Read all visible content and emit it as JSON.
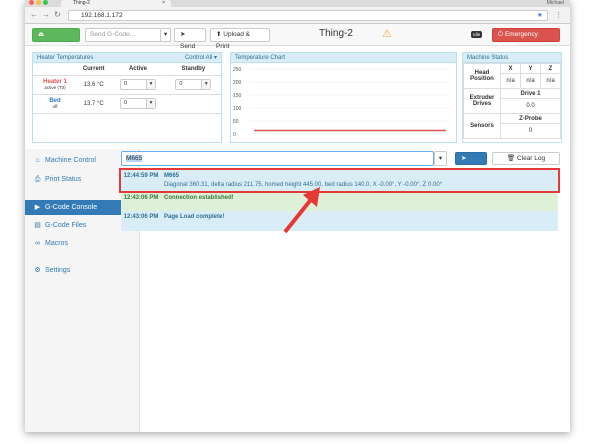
{
  "browser": {
    "tab_title": "Thing-2",
    "user_name": "Michael",
    "url": "192.168.1.172"
  },
  "toolbar": {
    "disconnect_label": "Disconnect",
    "gcode_placeholder": "Send G-Code...",
    "send_label": "Send",
    "upload_label": "Upload & Print",
    "machine_name": "Thing-2",
    "status_badge": "Idle",
    "estop_label": "Emergency STOP"
  },
  "heater_panel": {
    "title": "Heater Temperatures",
    "control_all": "Control All",
    "col_current": "Current",
    "col_active": "Active",
    "col_standby": "Standby",
    "heater1_name": "Heater 1",
    "heater1_state": "active (T0)",
    "heater1_current": "13.6 °C",
    "heater1_active": "0",
    "heater1_standby": "0",
    "bed_name": "Bed",
    "bed_state": "off",
    "bed_current": "13.7 °C",
    "bed_active": "0"
  },
  "temp_chart": {
    "title": "Temperature Chart",
    "y_ticks": [
      "250",
      "200",
      "150",
      "100",
      "50",
      "0"
    ]
  },
  "chart_data": {
    "type": "line",
    "title": "Temperature Chart",
    "ylim": [
      0,
      250
    ],
    "y_ticks": [
      250,
      200,
      150,
      100,
      50,
      0
    ],
    "series": [
      {
        "values": [
          13.6,
          13.6,
          13.6,
          13.6,
          13.6
        ],
        "color": "#d9534f"
      }
    ]
  },
  "machine_status": {
    "title": "Machine Status",
    "head_position": "Head Position",
    "col_x": "X",
    "col_y": "Y",
    "col_z": "Z",
    "x_val": "n/a",
    "y_val": "n/a",
    "z_val": "n/a",
    "extruder_drives": "Extruder Drives",
    "drive1": "Drive 1",
    "drive1_val": "0.0",
    "sensors": "Sensors",
    "zprobe": "Z-Probe",
    "zprobe_val": "0"
  },
  "sidebar": {
    "items": [
      {
        "label": "Machine Control"
      },
      {
        "label": "Print Status"
      },
      {
        "label": "G-Code Console"
      },
      {
        "label": "G-Code Files"
      },
      {
        "label": "Macros"
      },
      {
        "label": "Settings"
      }
    ]
  },
  "console": {
    "input_value": "M665",
    "send_label": "Send",
    "clear_label": "Clear Log",
    "entries": [
      {
        "time": "12:44:59 PM",
        "command": "M665",
        "message": "Diagonal 360.31, delta radius 211.75, homed height 445.00, bed radius 140.0, X -0.00°, Y -0.00°, Z 0.00°"
      },
      {
        "time": "12:43:06 PM",
        "message": "Connection established!"
      },
      {
        "time": "12:43:06 PM",
        "message": "Page Load complete!"
      }
    ]
  },
  "colors": {
    "accent": "#337ab7",
    "success": "#5cb85c",
    "danger": "#d9534f",
    "annotation": "#e53935"
  }
}
